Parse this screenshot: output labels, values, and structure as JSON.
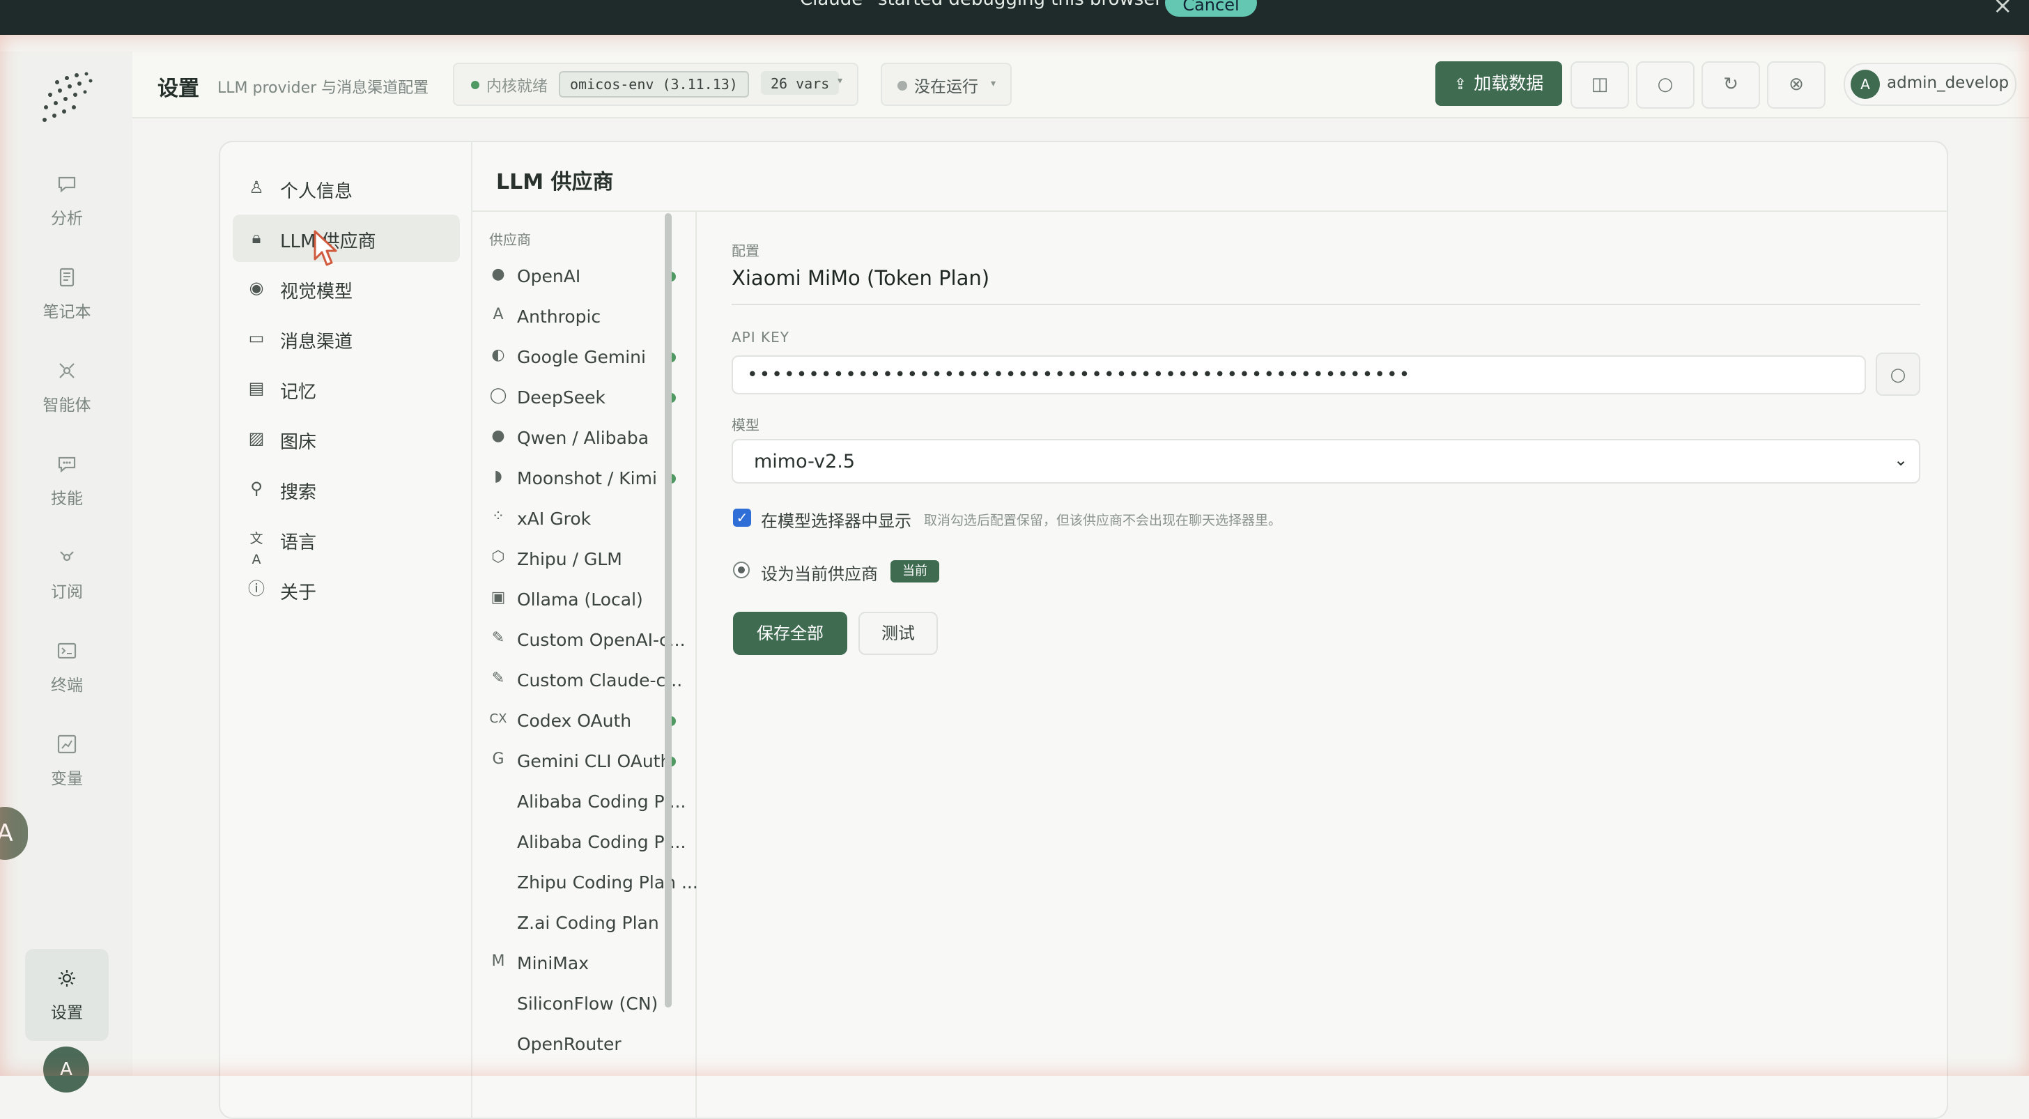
{
  "banner": {
    "text": "Claude “started debugging this browser”",
    "cancel_label": "Cancel"
  },
  "rail": {
    "items": [
      {
        "label": "分析",
        "icon": "chat-bubble-icon"
      },
      {
        "label": "笔记本",
        "icon": "notebook-icon"
      },
      {
        "label": "智能体",
        "icon": "agent-node-icon"
      },
      {
        "label": "技能",
        "icon": "skill-bubble-icon"
      },
      {
        "label": "订阅",
        "icon": "subscription-icon"
      },
      {
        "label": "终端",
        "icon": "terminal-icon"
      },
      {
        "label": "变量",
        "icon": "variable-chart-icon"
      },
      {
        "label": "设置",
        "icon": "gear-icon"
      }
    ],
    "floating_avatar": "A",
    "user_avatar": "A"
  },
  "header": {
    "title": "设置",
    "subtitle": "LLM provider 与消息渠道配置",
    "kernel": {
      "label": "内核就绪",
      "env": "omicos-env (3.11.13)",
      "vars": "26 vars"
    },
    "run_state": "没在运行",
    "load_button": "加载数据",
    "user": {
      "initial": "A",
      "name": "admin_develop"
    }
  },
  "settings_nav": [
    {
      "label": "个人信息",
      "icon": "user-icon"
    },
    {
      "label": "LLM 供应商",
      "icon": "lock-icon"
    },
    {
      "label": "视觉模型",
      "icon": "eye-icon"
    },
    {
      "label": "消息渠道",
      "icon": "message-icon"
    },
    {
      "label": "记忆",
      "icon": "memory-icon"
    },
    {
      "label": "图床",
      "icon": "image-icon"
    },
    {
      "label": "搜索",
      "icon": "search-icon"
    },
    {
      "label": "语言",
      "icon": "language-icon"
    },
    {
      "label": "关于",
      "icon": "info-icon"
    }
  ],
  "content": {
    "title": "LLM 供应商",
    "providers_header": "供应商",
    "providers": [
      {
        "name": "OpenAI",
        "icon": "●",
        "configured": true
      },
      {
        "name": "Anthropic",
        "icon": "A",
        "configured": false
      },
      {
        "name": "Google Gemini",
        "icon": "◐",
        "configured": true
      },
      {
        "name": "DeepSeek",
        "icon": "◯",
        "configured": true
      },
      {
        "name": "Qwen / Alibaba",
        "icon": "●",
        "configured": false
      },
      {
        "name": "Moonshot / Kimi",
        "icon": "◗",
        "configured": true
      },
      {
        "name": "xAI Grok",
        "icon": "⁘",
        "configured": false
      },
      {
        "name": "Zhipu / GLM",
        "icon": "⬡",
        "configured": false
      },
      {
        "name": "Ollama (Local)",
        "icon": "▣",
        "configured": false
      },
      {
        "name": "Custom OpenAI-c...",
        "icon": "✎",
        "configured": false
      },
      {
        "name": "Custom Claude-c...",
        "icon": "✎",
        "configured": false
      },
      {
        "name": "Codex OAuth",
        "icon": "CX",
        "configured": true
      },
      {
        "name": "Gemini CLI OAuth",
        "icon": "G",
        "configured": true
      },
      {
        "name": "Alibaba Coding Pl...",
        "icon": "",
        "configured": false
      },
      {
        "name": "Alibaba Coding Pl...",
        "icon": "",
        "configured": false
      },
      {
        "name": "Zhipu Coding Plan ...",
        "icon": "",
        "configured": false
      },
      {
        "name": "Z.ai Coding Plan",
        "icon": "",
        "configured": false
      },
      {
        "name": "MiniMax",
        "icon": "M",
        "configured": false
      },
      {
        "name": "SiliconFlow (CN)",
        "icon": "",
        "configured": false
      },
      {
        "name": "OpenRouter",
        "icon": "",
        "configured": false
      }
    ],
    "config": {
      "section_label": "配置",
      "provider_name": "Xiaomi MiMo (Token Plan)",
      "api_key_label": "API KEY",
      "api_key_value": "••••••••••••••••••••••••••••••••••••••••••••••••••••••",
      "model_label": "模型",
      "model_value": "mimo-v2.5",
      "show_in_selector_label": "在模型选择器中显示",
      "show_in_selector_hint": "取消勾选后配置保留，但该供应商不会出现在聊天选择器里。",
      "set_current_label": "设为当前供应商",
      "current_badge": "当前",
      "save_button": "保存全部",
      "test_button": "测试"
    }
  },
  "colors": {
    "accent": "#3f6b51",
    "status_ok": "#4f9a62",
    "banner_bg": "#1f2b2a",
    "cancel_bg": "#63c7b2"
  }
}
